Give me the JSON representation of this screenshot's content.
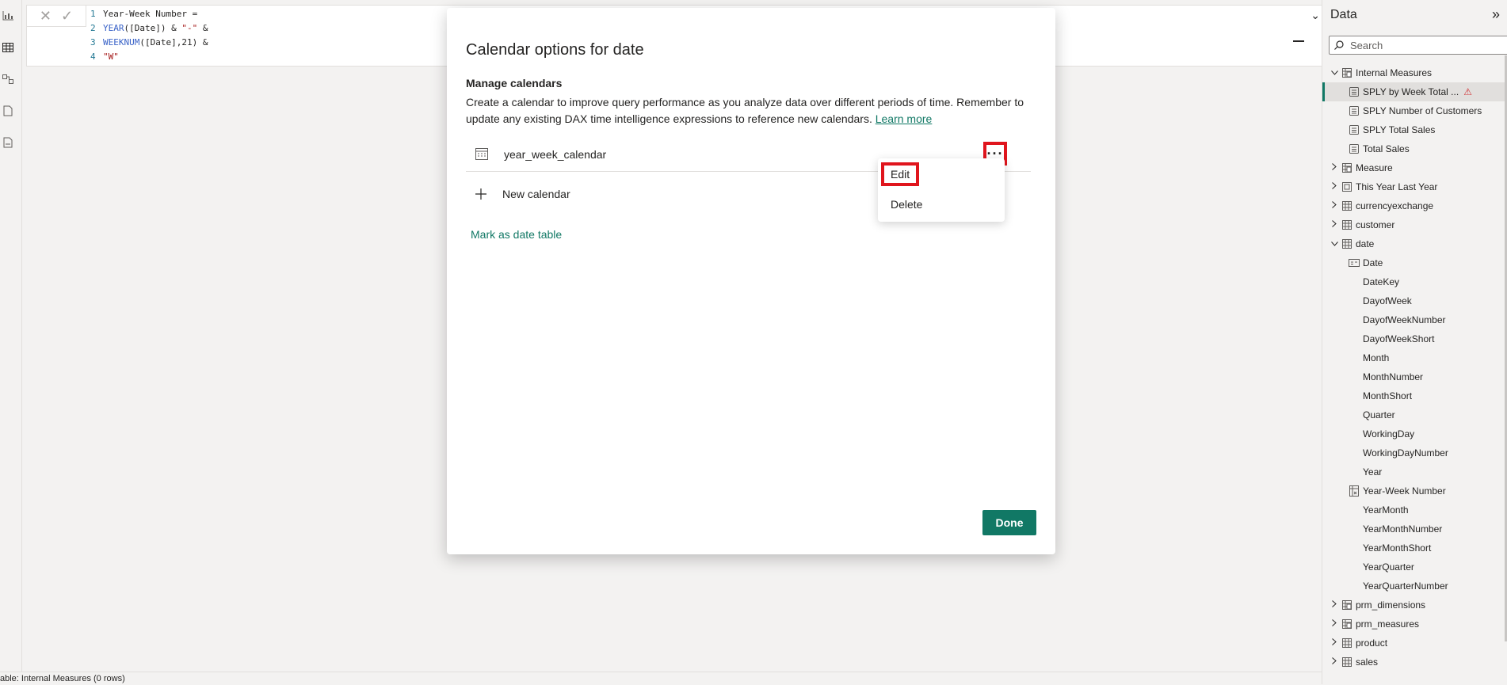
{
  "formula_bar": {
    "lines": [
      {
        "num": "1",
        "parts": [
          {
            "t": "Year-Week Number =",
            "c": ""
          }
        ]
      },
      {
        "num": "2",
        "parts": [
          {
            "t": "YEAR",
            "c": "kw"
          },
          {
            "t": "([Date]) & ",
            "c": ""
          },
          {
            "t": "\"-\"",
            "c": "str"
          },
          {
            "t": " &",
            "c": ""
          }
        ]
      },
      {
        "num": "3",
        "parts": [
          {
            "t": "WEEKNUM",
            "c": "kw"
          },
          {
            "t": "([Date],21) &",
            "c": ""
          }
        ]
      },
      {
        "num": "4",
        "parts": [
          {
            "t": "\"W\"",
            "c": "str"
          }
        ]
      }
    ]
  },
  "status_bar": {
    "text": "able: Internal Measures (0 rows)"
  },
  "data_pane": {
    "title": "Data",
    "search_placeholder": "Search",
    "items": [
      {
        "label": "Internal Measures",
        "level": 0,
        "chevron": "open",
        "icon": "measure-table-icon"
      },
      {
        "label": "SPLY by Week Total ...",
        "level": 1,
        "icon": "measure-icon",
        "selected": true,
        "warning": true
      },
      {
        "label": "SPLY Number of Customers",
        "level": 1,
        "icon": "measure-icon"
      },
      {
        "label": "SPLY Total Sales",
        "level": 1,
        "icon": "measure-icon"
      },
      {
        "label": "Total Sales",
        "level": 1,
        "icon": "measure-icon"
      },
      {
        "label": "Measure",
        "level": 0,
        "chevron": "closed",
        "icon": "measure-table-icon"
      },
      {
        "label": "This Year Last Year",
        "level": 0,
        "chevron": "closed",
        "icon": "calc-group-icon"
      },
      {
        "label": "currencyexchange",
        "level": 0,
        "chevron": "closed",
        "icon": "table-icon"
      },
      {
        "label": "customer",
        "level": 0,
        "chevron": "closed",
        "icon": "table-icon"
      },
      {
        "label": "date",
        "level": 0,
        "chevron": "open",
        "icon": "table-icon"
      },
      {
        "label": "Date",
        "level": 1,
        "icon": "date-field-icon"
      },
      {
        "label": "DateKey",
        "level": 1,
        "icon": ""
      },
      {
        "label": "DayofWeek",
        "level": 1,
        "icon": ""
      },
      {
        "label": "DayofWeekNumber",
        "level": 1,
        "icon": ""
      },
      {
        "label": "DayofWeekShort",
        "level": 1,
        "icon": ""
      },
      {
        "label": "Month",
        "level": 1,
        "icon": ""
      },
      {
        "label": "MonthNumber",
        "level": 1,
        "icon": ""
      },
      {
        "label": "MonthShort",
        "level": 1,
        "icon": ""
      },
      {
        "label": "Quarter",
        "level": 1,
        "icon": ""
      },
      {
        "label": "WorkingDay",
        "level": 1,
        "icon": ""
      },
      {
        "label": "WorkingDayNumber",
        "level": 1,
        "icon": ""
      },
      {
        "label": "Year",
        "level": 1,
        "icon": ""
      },
      {
        "label": "Year-Week Number",
        "level": 1,
        "icon": "calc-column-icon"
      },
      {
        "label": "YearMonth",
        "level": 1,
        "icon": ""
      },
      {
        "label": "YearMonthNumber",
        "level": 1,
        "icon": ""
      },
      {
        "label": "YearMonthShort",
        "level": 1,
        "icon": ""
      },
      {
        "label": "YearQuarter",
        "level": 1,
        "icon": ""
      },
      {
        "label": "YearQuarterNumber",
        "level": 1,
        "icon": ""
      },
      {
        "label": "prm_dimensions",
        "level": 0,
        "chevron": "closed",
        "icon": "measure-table-icon"
      },
      {
        "label": "prm_measures",
        "level": 0,
        "chevron": "closed",
        "icon": "measure-table-icon"
      },
      {
        "label": "product",
        "level": 0,
        "chevron": "closed",
        "icon": "table-icon"
      },
      {
        "label": "sales",
        "level": 0,
        "chevron": "closed",
        "icon": "table-icon"
      }
    ]
  },
  "modal": {
    "title": "Calendar options for date",
    "section_title": "Manage calendars",
    "description": "Create a calendar to improve query performance as you analyze data over different periods of time. Remember to update any existing DAX time intelligence expressions to reference new calendars.",
    "learn_more": "Learn more",
    "calendar_name": "year_week_calendar",
    "more_label": "···",
    "new_calendar": "New calendar",
    "mark_date_table": "Mark as date table",
    "done": "Done"
  },
  "context_menu": {
    "edit": "Edit",
    "delete": "Delete"
  },
  "colors": {
    "accent": "#117865",
    "highlight": "#e0151d",
    "warning": "#d13438"
  }
}
